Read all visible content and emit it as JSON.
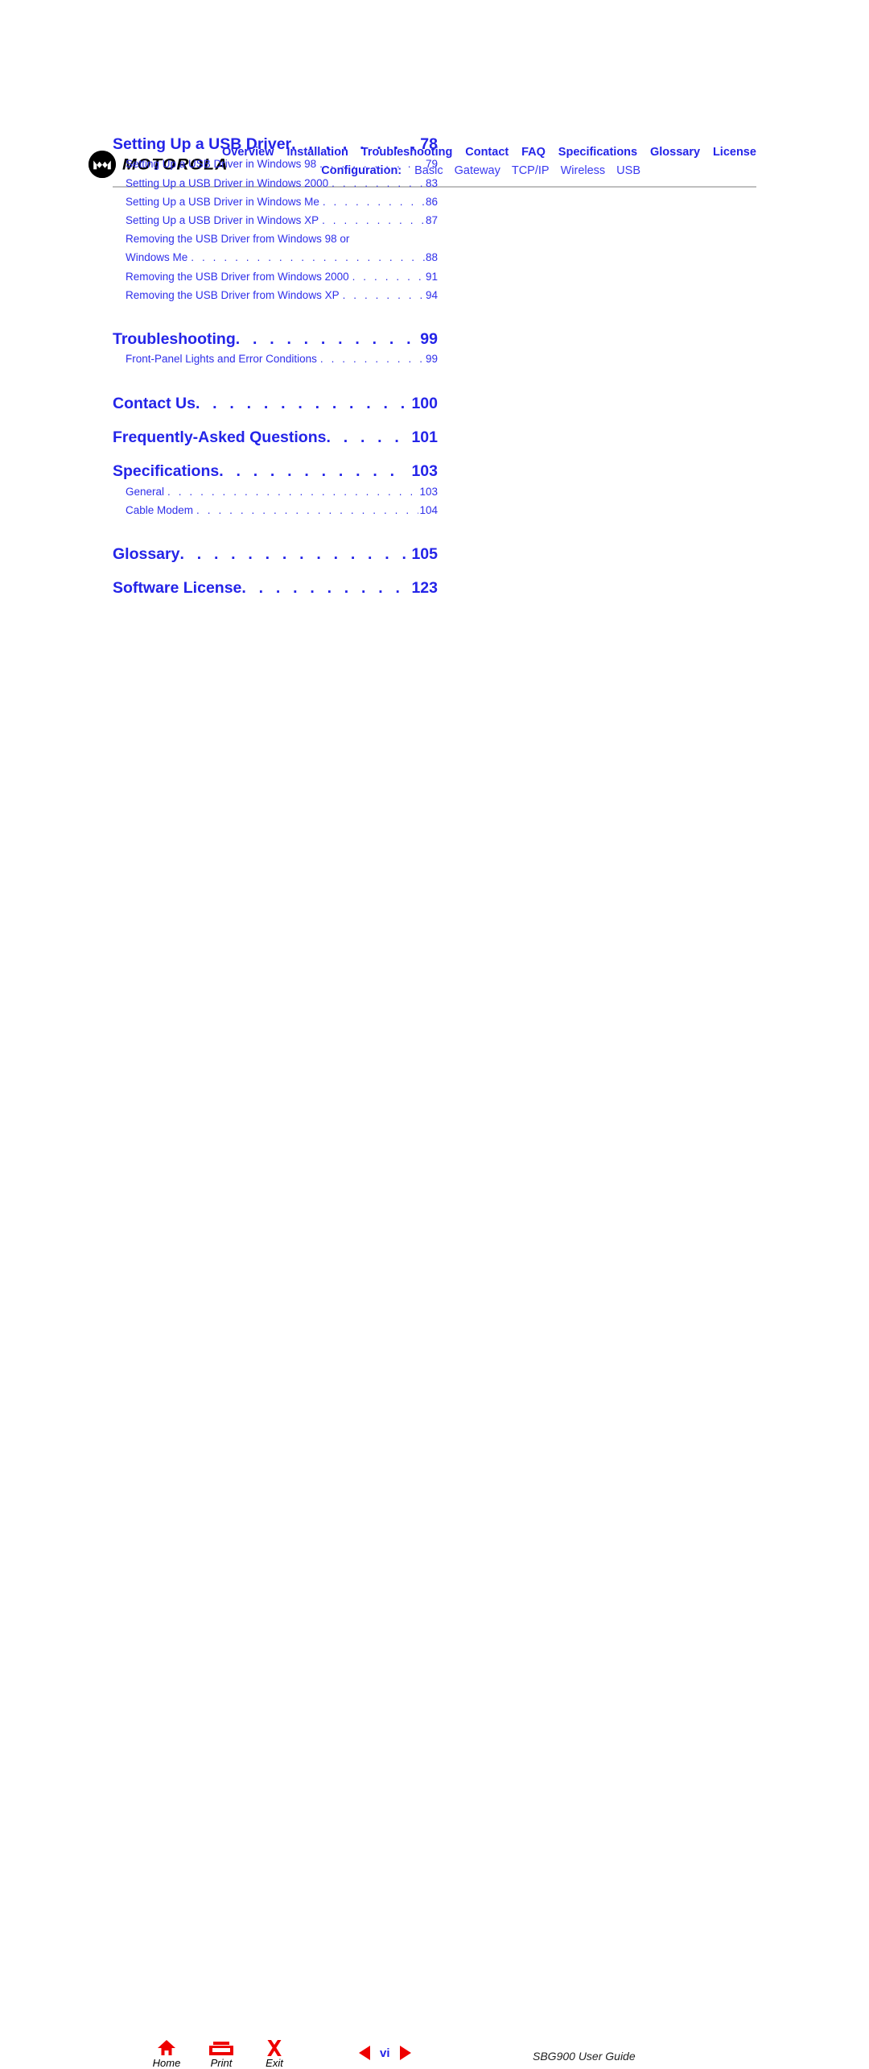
{
  "brand": {
    "name": "MOTOROLA",
    "logo_icon": "motorola-batwing-logo"
  },
  "header": {
    "primary_nav": [
      {
        "label": "Overview"
      },
      {
        "label": "Installation"
      },
      {
        "label": "Troubleshooting"
      },
      {
        "label": "Contact"
      },
      {
        "label": "FAQ"
      },
      {
        "label": "Specifications"
      },
      {
        "label": "Glossary"
      },
      {
        "label": "License"
      }
    ],
    "configuration_label": "Configuration:",
    "configuration_nav": [
      {
        "label": "Basic"
      },
      {
        "label": "Gateway"
      },
      {
        "label": "TCP/IP"
      },
      {
        "label": "Wireless"
      },
      {
        "label": "USB"
      }
    ]
  },
  "toc": {
    "sections": [
      {
        "title": "Setting Up a USB Driver",
        "page": "78",
        "entries": [
          {
            "title": "Setting Up a USB Driver in Windows 98",
            "page": "79"
          },
          {
            "title": "Setting Up a USB Driver in Windows 2000",
            "page": "83"
          },
          {
            "title": "Setting Up a USB Driver in Windows Me",
            "page": "86"
          },
          {
            "title": "Setting Up a USB Driver in Windows XP",
            "page": "87"
          },
          {
            "title": "Removing the USB Driver from Windows 98 or",
            "title_line2": "Windows Me",
            "page": "88",
            "wrapped": true
          },
          {
            "title": "Removing the USB Driver from Windows 2000",
            "page": "91"
          },
          {
            "title": "Removing the USB Driver from Windows XP",
            "page": "94"
          }
        ]
      },
      {
        "title": "Troubleshooting",
        "page": "99",
        "entries": [
          {
            "title": "Front-Panel Lights and Error Conditions",
            "page": "99"
          }
        ]
      },
      {
        "title": "Contact Us",
        "page": "100",
        "entries": []
      },
      {
        "title": "Frequently-Asked Questions",
        "page": "101",
        "entries": []
      },
      {
        "title": "Specifications",
        "page": "103",
        "entries": [
          {
            "title": "General",
            "page": "103"
          },
          {
            "title": "Cable Modem",
            "page": "104"
          }
        ]
      },
      {
        "title": "Glossary",
        "page": "105",
        "entries": []
      },
      {
        "title": "Software License",
        "page": "123",
        "entries": []
      }
    ],
    "leader_dots": ". . . . . . . . . . . . . . . . . . . . . . . . . . . . . . . . . . . . . . . . . . . . . . . . . . . . . . . . . . . . . . . . . . . ."
  },
  "footer": {
    "home_label": "Home",
    "home_icon": "home-icon",
    "print_label": "Print",
    "print_icon": "printer-icon",
    "exit_label": "Exit",
    "exit_icon": "close-x-icon",
    "prev_icon": "triangle-left-icon",
    "next_icon": "triangle-right-icon",
    "page_number": "vi",
    "document_title": "SBG900 User Guide"
  },
  "colors": {
    "link_blue": "#2424e8",
    "sub_blue": "#2f2fea",
    "accent_red": "#ee0000",
    "rule_gray": "#bfbfbf",
    "text_black": "#000000"
  }
}
